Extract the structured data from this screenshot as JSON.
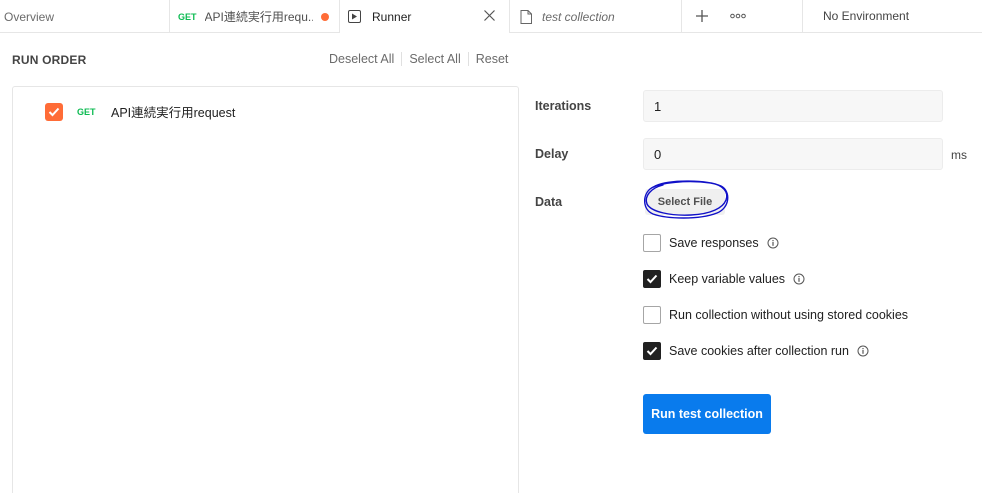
{
  "tabs": {
    "overview": "Overview",
    "request": {
      "method": "GET",
      "title": "API連続実行用requ..."
    },
    "runner": "Runner",
    "collection": "test collection",
    "environment": "No Environment"
  },
  "run_order": {
    "label": "RUN ORDER",
    "deselect_all": "Deselect All",
    "select_all": "Select All",
    "reset": "Reset",
    "requests": [
      {
        "method": "GET",
        "name": "API連続実行用request",
        "checked": true
      }
    ]
  },
  "settings": {
    "iterations_label": "Iterations",
    "iterations_value": "1",
    "delay_label": "Delay",
    "delay_value": "0",
    "delay_unit": "ms",
    "data_label": "Data",
    "select_file": "Select File",
    "options": [
      {
        "label": "Save responses",
        "checked": false,
        "info": true
      },
      {
        "label": "Keep variable values",
        "checked": true,
        "info": true
      },
      {
        "label": "Run collection without using stored cookies",
        "checked": false,
        "info": false
      },
      {
        "label": "Save cookies after collection run",
        "checked": true,
        "info": true
      }
    ],
    "run_button": "Run test collection"
  },
  "colors": {
    "accent_orange": "#ff6c37",
    "method_green": "#0cbb52",
    "primary_blue": "#097bed",
    "annotation_blue": "#1010c8"
  },
  "icons": {
    "runner": "play-square-icon",
    "close": "close-icon",
    "collection": "document-icon",
    "add": "plus-icon",
    "more": "more-horizontal-icon",
    "info": "info-icon",
    "check": "check-icon"
  }
}
